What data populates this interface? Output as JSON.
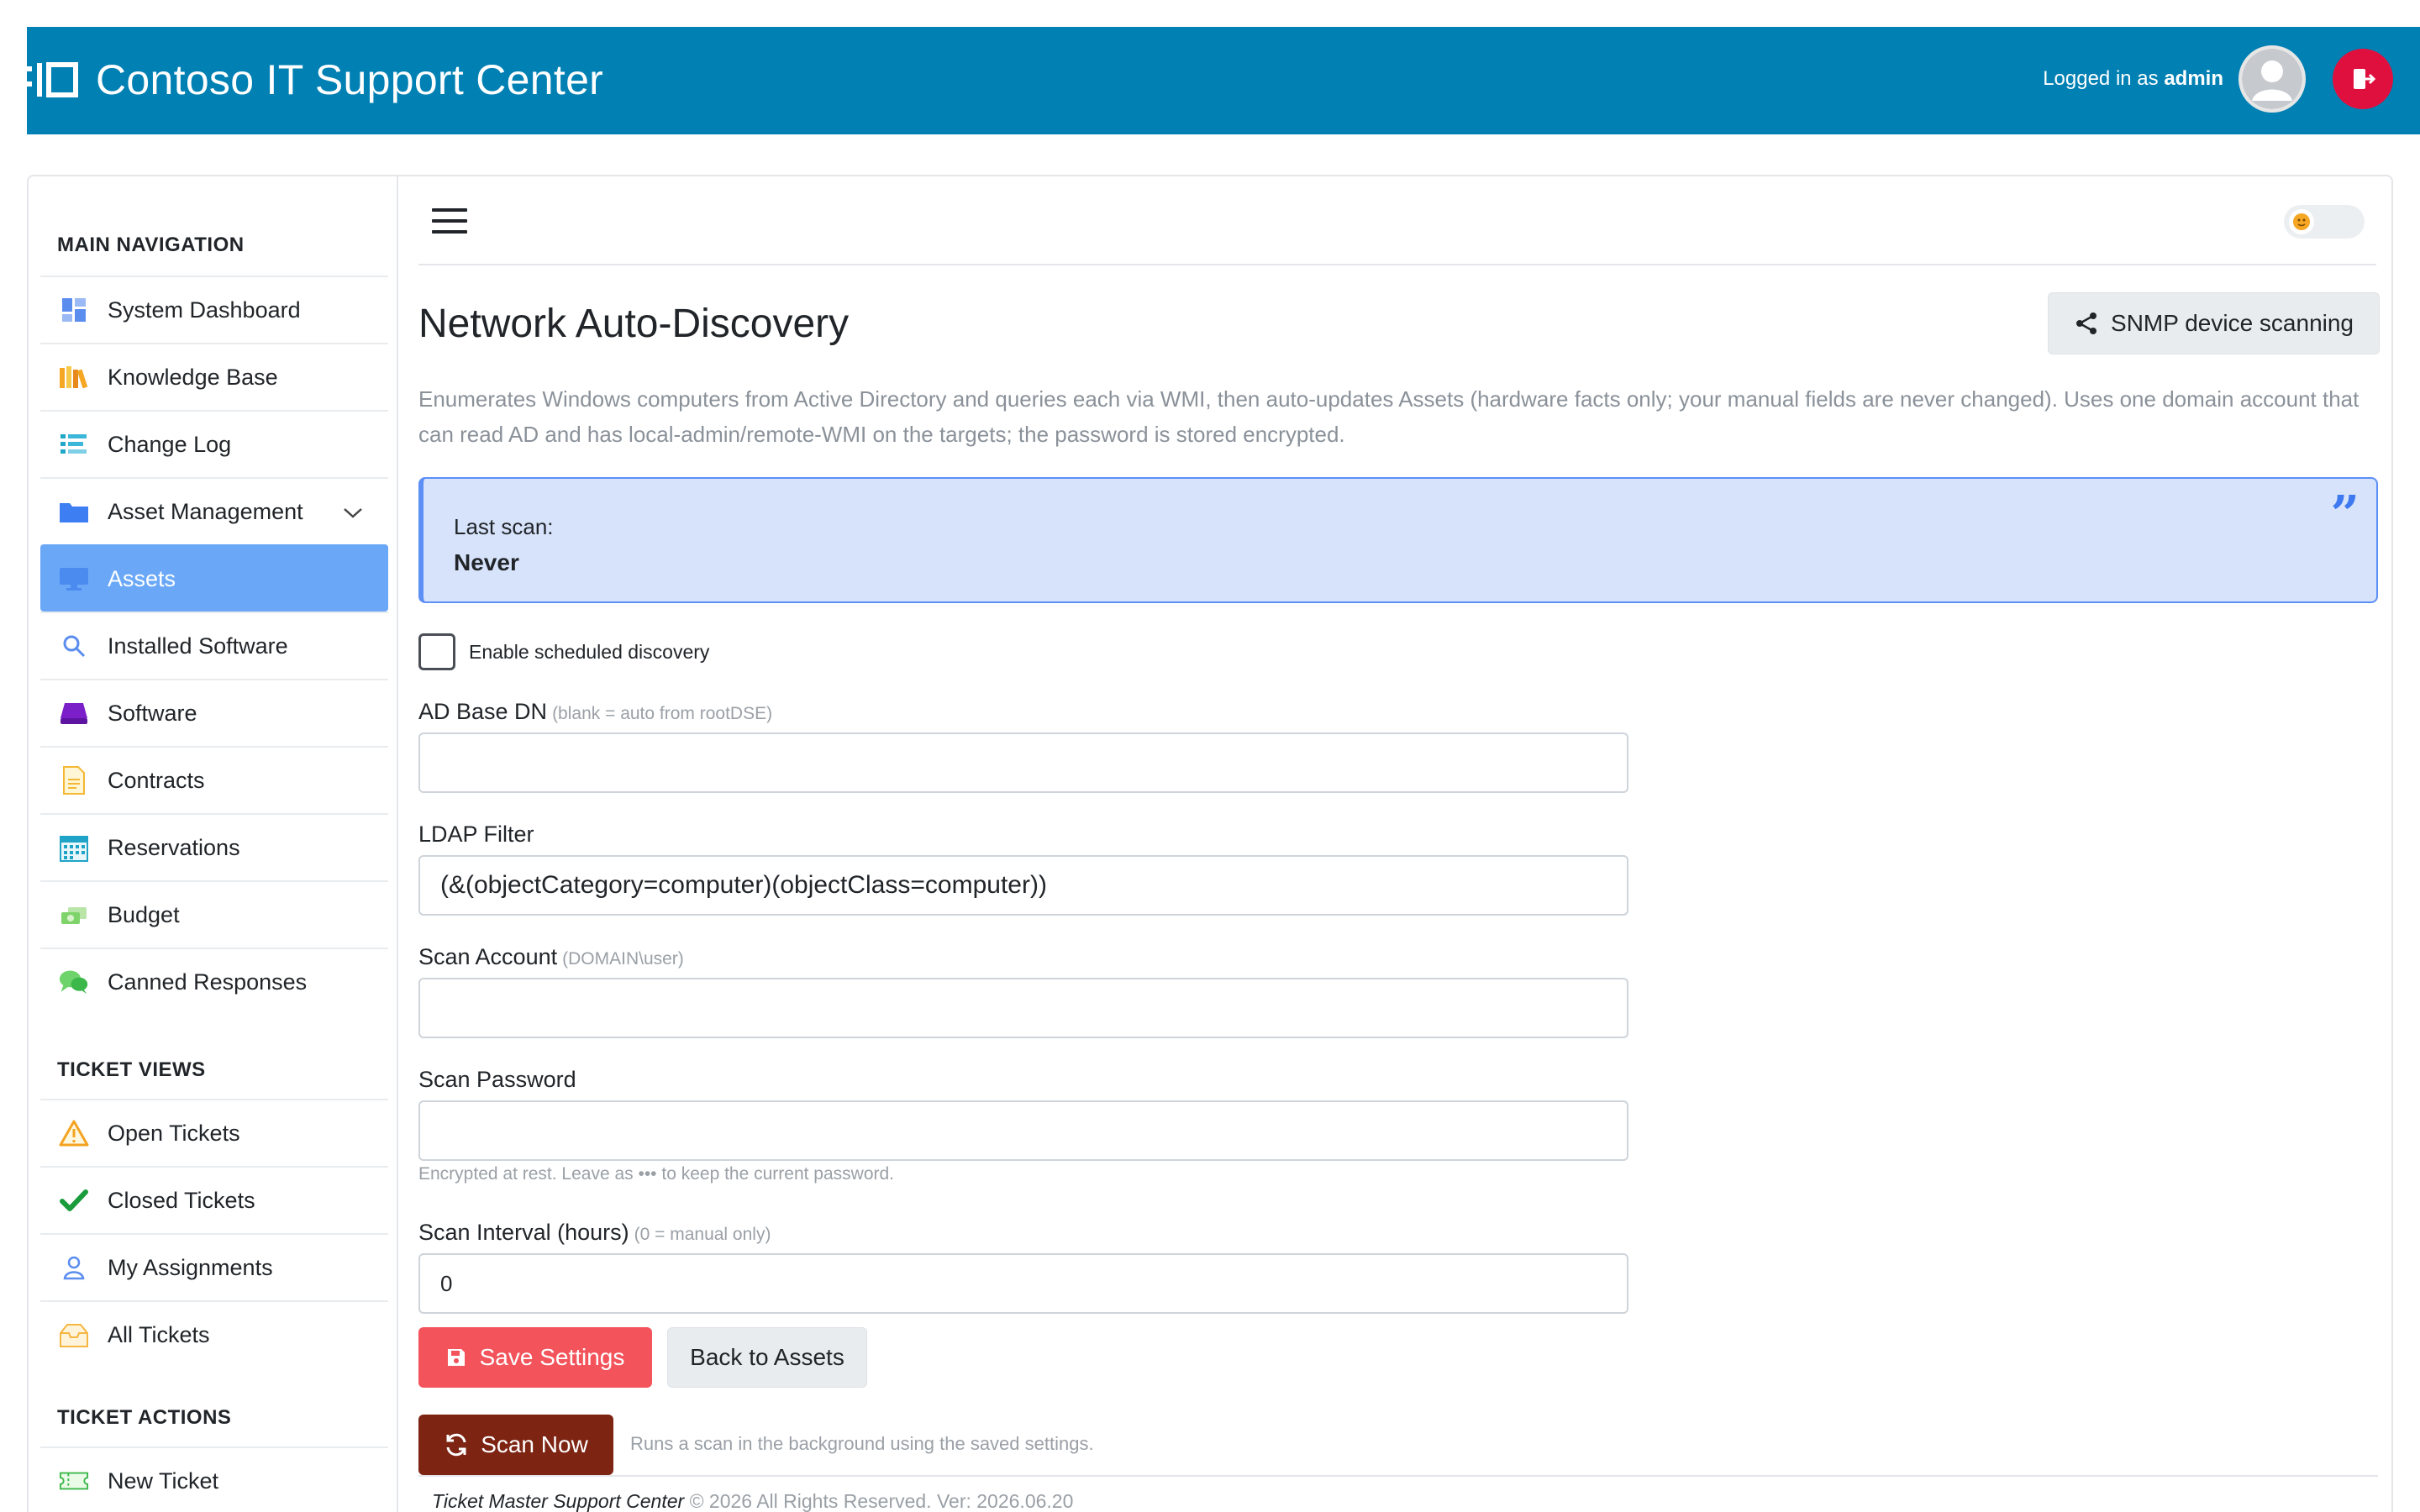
{
  "header": {
    "title": "Contoso IT Support Center",
    "logged_in_prefix": "Logged in as",
    "username": "admin",
    "colors": {
      "bar": "#0080b3",
      "logout": "#e0103e"
    }
  },
  "sidebar": {
    "main_heading": "MAIN NAVIGATION",
    "main_items": [
      {
        "label": "System Dashboard",
        "icon": "dashboard-icon"
      },
      {
        "label": "Knowledge Base",
        "icon": "books-icon"
      },
      {
        "label": "Change Log",
        "icon": "list-icon"
      },
      {
        "label": "Asset Management",
        "icon": "folder-icon",
        "expandable": true
      },
      {
        "label": "Assets",
        "icon": "monitor-icon",
        "active": true
      },
      {
        "label": "Installed Software",
        "icon": "search-icon"
      },
      {
        "label": "Software",
        "icon": "drive-icon"
      },
      {
        "label": "Contracts",
        "icon": "document-icon"
      },
      {
        "label": "Reservations",
        "icon": "calendar-icon"
      },
      {
        "label": "Budget",
        "icon": "money-icon"
      },
      {
        "label": "Canned Responses",
        "icon": "chat-icon"
      }
    ],
    "ticket_views_heading": "TICKET VIEWS",
    "ticket_views": [
      {
        "label": "Open Tickets",
        "icon": "warning-icon"
      },
      {
        "label": "Closed Tickets",
        "icon": "checkmark-icon"
      },
      {
        "label": "My Assignments",
        "icon": "user-icon"
      },
      {
        "label": "All Tickets",
        "icon": "inbox-icon"
      }
    ],
    "ticket_actions_heading": "TICKET ACTIONS",
    "ticket_actions": [
      {
        "label": "New Ticket",
        "icon": "ticket-icon"
      }
    ]
  },
  "page": {
    "title": "Network Auto-Discovery",
    "snmp_button": "SNMP device scanning",
    "intro": "Enumerates Windows computers from Active Directory and queries each via WMI, then auto-updates Assets (hardware facts only; your manual fields are never changed). Uses one domain account that can read AD and has local-admin/remote-WMI on the targets; the password is stored encrypted.",
    "last_scan_label": "Last scan:",
    "last_scan_value": "Never"
  },
  "form": {
    "enable_label": "Enable scheduled discovery",
    "enable_checked": false,
    "base_dn_label": "AD Base DN",
    "base_dn_hint": "(blank = auto from rootDSE)",
    "base_dn_value": "",
    "ldap_label": "LDAP Filter",
    "ldap_value": "(&(objectCategory=computer)(objectClass=computer))",
    "account_label": "Scan Account",
    "account_hint": "(DOMAIN\\user)",
    "account_value": "",
    "password_label": "Scan Password",
    "password_value": "",
    "password_help": "Encrypted at rest. Leave as ••• to keep the current password.",
    "interval_label": "Scan Interval (hours)",
    "interval_hint": "(0 = manual only)",
    "interval_value": "0"
  },
  "actions": {
    "save": "Save Settings",
    "back": "Back to Assets",
    "scan": "Scan Now",
    "scan_note": "Runs a scan in the background using the saved settings."
  },
  "footer": {
    "app_name": "Ticket Master Support Center",
    "text": "© 2026 All Rights Reserved. Ver: 2026.06.20"
  }
}
